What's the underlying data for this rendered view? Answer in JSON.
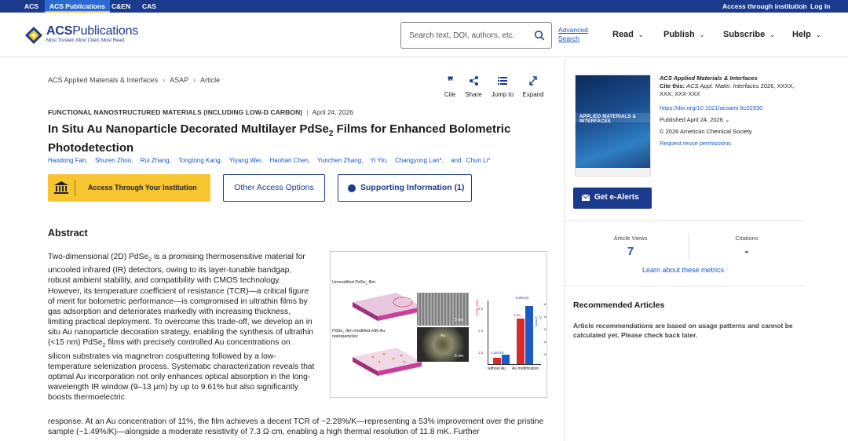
{
  "topbar": {
    "links": [
      "ACS",
      "ACS Publications",
      "C&EN",
      "CAS"
    ],
    "access_institution": "Access through institution",
    "login": "Log In",
    "separator": "|"
  },
  "header": {
    "logo_title_prefix": "ACS",
    "logo_title_suffix": "Publications",
    "logo_tagline": "Most Trusted. Most Cited. Most Read.",
    "search_placeholder": "Search text, DOI, authors, etc.",
    "advanced_search": "Advanced Search",
    "nav": [
      {
        "label": "Read"
      },
      {
        "label": "Publish"
      },
      {
        "label": "Subscribe"
      },
      {
        "label": "Help"
      }
    ]
  },
  "breadcrumb": [
    "ACS Applied Materials & Interfaces",
    "ASAP",
    "Article"
  ],
  "tools": [
    {
      "label": "Cite",
      "icon": "quote-icon"
    },
    {
      "label": "Share",
      "icon": "share-icon"
    },
    {
      "label": "Jump to",
      "icon": "list-icon"
    },
    {
      "label": "Expand",
      "icon": "expand-icon"
    }
  ],
  "article": {
    "section": "FUNCTIONAL NANOSTRUCTURED MATERIALS (INCLUDING LOW-D CARBON)",
    "date": "April 24, 2026",
    "title_a": "In Situ Au Nanoparticle Decorated Multilayer PdSe",
    "title_sub": "2",
    "title_b": " Films for Enhanced Bolometric Photodetection",
    "authors": [
      "Haodong Fan,",
      "Shuren Zhou,",
      "Rui Zhang,",
      "Tongtong Kang,",
      "Yiyang Wei,",
      "Haohan Chen,",
      "Yunchen Zhang,",
      "Yi Yin,",
      "Changyong Lan*,",
      "and",
      "Chun Li*"
    ],
    "access_button": "Access Through Your Institution",
    "other_access": "Other Access Options",
    "supporting_info": "Supporting Information (1)"
  },
  "abstract": {
    "heading": "Abstract",
    "p1_a": "Two-dimensional (2D) PdSe",
    "p1_sub": "2",
    "p1_b": " is a promising thermosensitive material for uncooled infrared (IR) detectors, owing to its layer-tunable bandgap, robust ambient stability, and compatibility with CMOS technology. However, its temperature coefficient of resistance (TCR)—a critical figure of merit for bolometric performance—is compromised in ultrathin films by gas adsorption and deteriorates markedly with increasing thickness, limiting practical deployment. To overcome this trade-off, we develop an in situ Au nanoparticle decoration strategy, enabling the synthesis of ultrathin (<15 nm) PdSe",
    "p1_sub2": "2",
    "p1_c": " films with precisely controlled Au concentrations on silicon substrates via magnetron cosputtering followed by a low-temperature selenization process. Systematic characterization reveals that optimal Au incorporation not only enhances optical absorption in the long-wavelength IR window (9–13 μm) by up to 9.61% but also significantly boosts thermoelectric",
    "p2": "response. At an Au concentration of 11%, the film achieves a decent TCR of −2.28%/K—representing a 53% improvement over the pristine sample (−1.49%/K)—alongside a moderate resistivity of 7.3 Ω·cm, enabling a high thermal resolution of 11.8 mK. Further"
  },
  "toc": {
    "cap1_a": "Unmodified PdSe",
    "cap1_sub": "2",
    "cap1_b": " film",
    "cap2_a": "PdSe",
    "cap2_sub": "2",
    "cap2_b": " film modified with Au nanoparticles",
    "scale": "5 nm",
    "au_label": "Au",
    "bar_top": "5.09×10",
    "bar_left": "1.34×10",
    "x_labels": [
      "without Au",
      "Au modification"
    ],
    "bar_mid_label": "2.28",
    "y_left_ticks": [
      "2.5",
      "2.0",
      "1.5"
    ],
    "y_right_ticks": [
      "10",
      "10",
      "10",
      "10",
      "10"
    ],
    "y_left_title": "|TCR| (%/K)",
    "y_right_title": "D* (Jones)"
  },
  "sidebar": {
    "cover_title": "APPLIED MATERIALS & INTERFACES",
    "journal": "ACS Applied Materials & Interfaces",
    "cite_label": "Cite this:",
    "cite_journal": "ACS Appl. Mater. Interfaces",
    "cite_rest": " 2026, XXXX, XXX, XXX-XXX",
    "doi": "https://doi.org/10.1021/acsami.6c02930",
    "published": "Published April 24, 2026",
    "copyright": "© 2026 American Chemical Society",
    "reuse": "Request reuse permissions",
    "alerts": "Get e-Alerts",
    "views_label": "Article Views",
    "views_value": "7",
    "citations_label": "Citations",
    "citations_value": "-",
    "learn_more": "Learn about these metrics",
    "recommended_heading": "Recommended Articles",
    "recommended_text": "Article recommendations are based on usage patterns and cannot be calculated yet. Please check back later."
  },
  "colors": {
    "brand_blue": "#1b3a8c",
    "link_blue": "#1a56c4",
    "access_yellow": "#f7c52f"
  }
}
